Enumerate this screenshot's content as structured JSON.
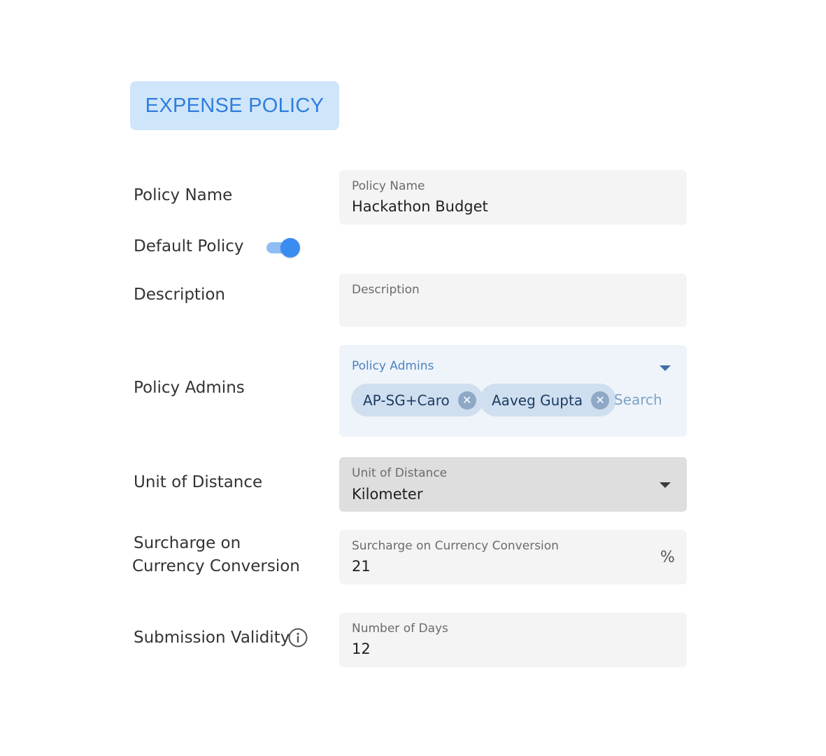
{
  "header": {
    "title": "EXPENSE POLICY",
    "accent_color": "#2f7de0",
    "badge_color": "#cfe6fa"
  },
  "form": {
    "policy_name": {
      "row_label": "Policy Name",
      "field_label": "Policy Name",
      "value": "Hackathon Budget"
    },
    "default_policy": {
      "row_label": "Default Policy",
      "enabled": true
    },
    "description": {
      "row_label": "Description",
      "field_label": "Description",
      "value": ""
    },
    "policy_admins": {
      "row_label": "Policy Admins",
      "field_label": "Policy Admins",
      "chips": [
        "AP-SG+Caro",
        "Aaveg Gupta"
      ],
      "search_placeholder": "Search",
      "dropdown_icon": "caret-down-icon"
    },
    "unit_of_distance": {
      "row_label": "Unit of Distance",
      "field_label": "Unit of Distance",
      "value": "Kilometer",
      "dropdown_icon": "caret-down-icon"
    },
    "surcharge": {
      "row_label_line1": "Surcharge on",
      "row_label_line2": "Currency Conversion",
      "field_label": "Surcharge on Currency Conversion",
      "value": "21",
      "suffix": "%"
    },
    "submission_validity": {
      "row_label": "Submission Validity",
      "info_icon": "info-icon",
      "field_label": "Number of Days",
      "value": "12"
    }
  }
}
